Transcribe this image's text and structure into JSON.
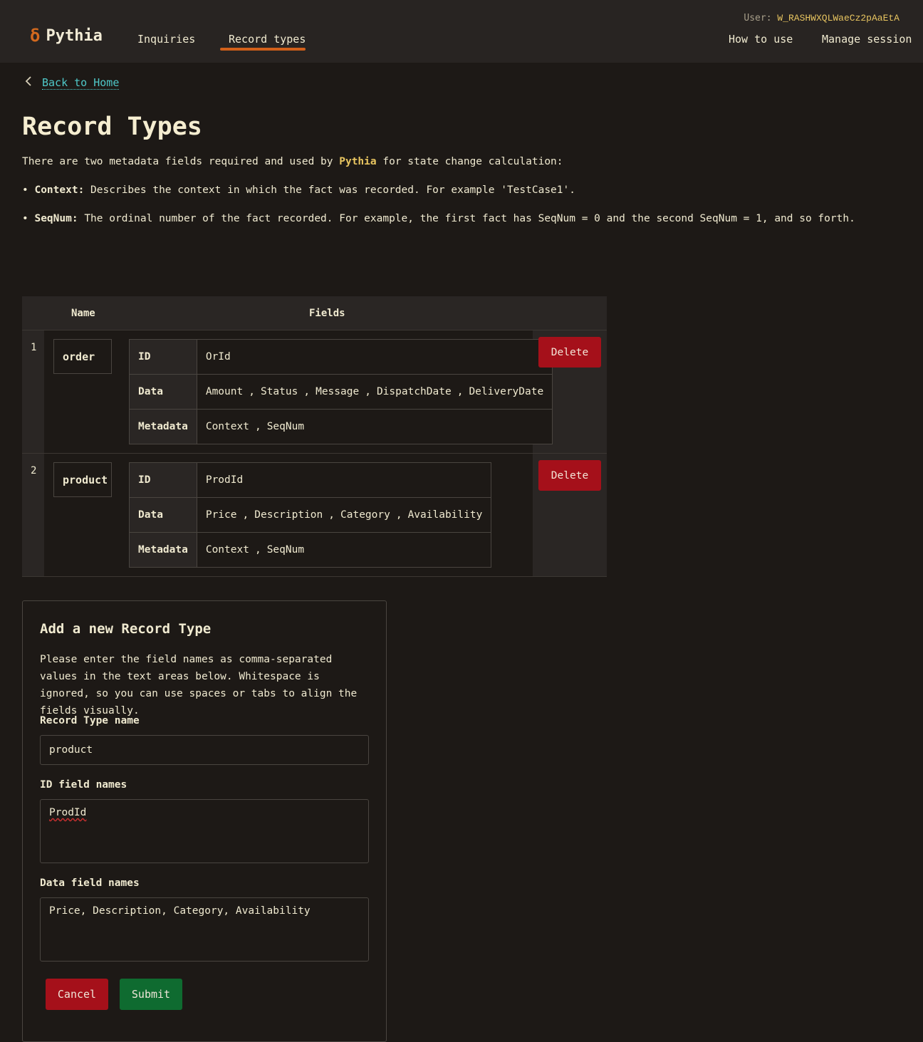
{
  "header": {
    "brand": "Pythia",
    "nav": [
      {
        "label": "Inquiries"
      },
      {
        "label": "Record types",
        "active": true
      }
    ],
    "right_nav": [
      {
        "label": "How to use"
      },
      {
        "label": "Manage session"
      }
    ],
    "user_label": "User:",
    "user_value": "W_RASHWXQLWaeCz2pAaEtA"
  },
  "back": {
    "label": "Back to Home"
  },
  "page": {
    "title": "Record Types",
    "intro_pre": "There are two metadata fields required and used by",
    "intro_brand": "Pythia",
    "intro_post": "for state change calculation:",
    "bullets": [
      {
        "term": "Context:",
        "text": "Describes the context in which the fact was recorded. For example 'TestCase1'."
      },
      {
        "term": "SeqNum:",
        "text": "The ordinal number of the fact recorded. For example, the first fact has SeqNum = 0 and the second SeqNum = 1, and so forth."
      }
    ]
  },
  "table": {
    "headers": {
      "name": "Name",
      "fields": "Fields"
    },
    "rows": [
      {
        "num": "1",
        "name": "order",
        "id_label": "ID",
        "id_fields": [
          "OrId"
        ],
        "data_label": "Data",
        "data_fields": [
          "Amount",
          "Status",
          "Message",
          "DispatchDate",
          "DeliveryDate"
        ],
        "meta_label": "Metadata",
        "meta_fields": [
          "Context",
          "SeqNum"
        ],
        "delete_label": "Delete"
      },
      {
        "num": "2",
        "name": "product",
        "id_label": "ID",
        "id_fields": [
          "ProdId"
        ],
        "data_label": "Data",
        "data_fields": [
          "Price",
          "Description",
          "Category",
          "Availability"
        ],
        "meta_label": "Metadata",
        "meta_fields": [
          "Context",
          "SeqNum"
        ],
        "delete_label": "Delete"
      }
    ],
    "separator": ","
  },
  "form": {
    "title": "Add a new Record Type",
    "description": "Please enter the field names as comma-separated values in the text areas below. Whitespace is ignored, so you can use spaces or tabs to align the fields visually.",
    "name_label": "Record Type name",
    "name_value": "product",
    "id_label": "ID field names",
    "id_value": "ProdId",
    "data_label": "Data field names",
    "data_value": "Price, Description, Category, Availability",
    "cancel_label": "Cancel",
    "submit_label": "Submit"
  },
  "colors": {
    "background": "#1d1916",
    "accent": "#d2601a",
    "danger": "#a5101a",
    "success": "#0f6b30",
    "link": "#4fc8c8",
    "brand_highlight": "#e8c560"
  }
}
